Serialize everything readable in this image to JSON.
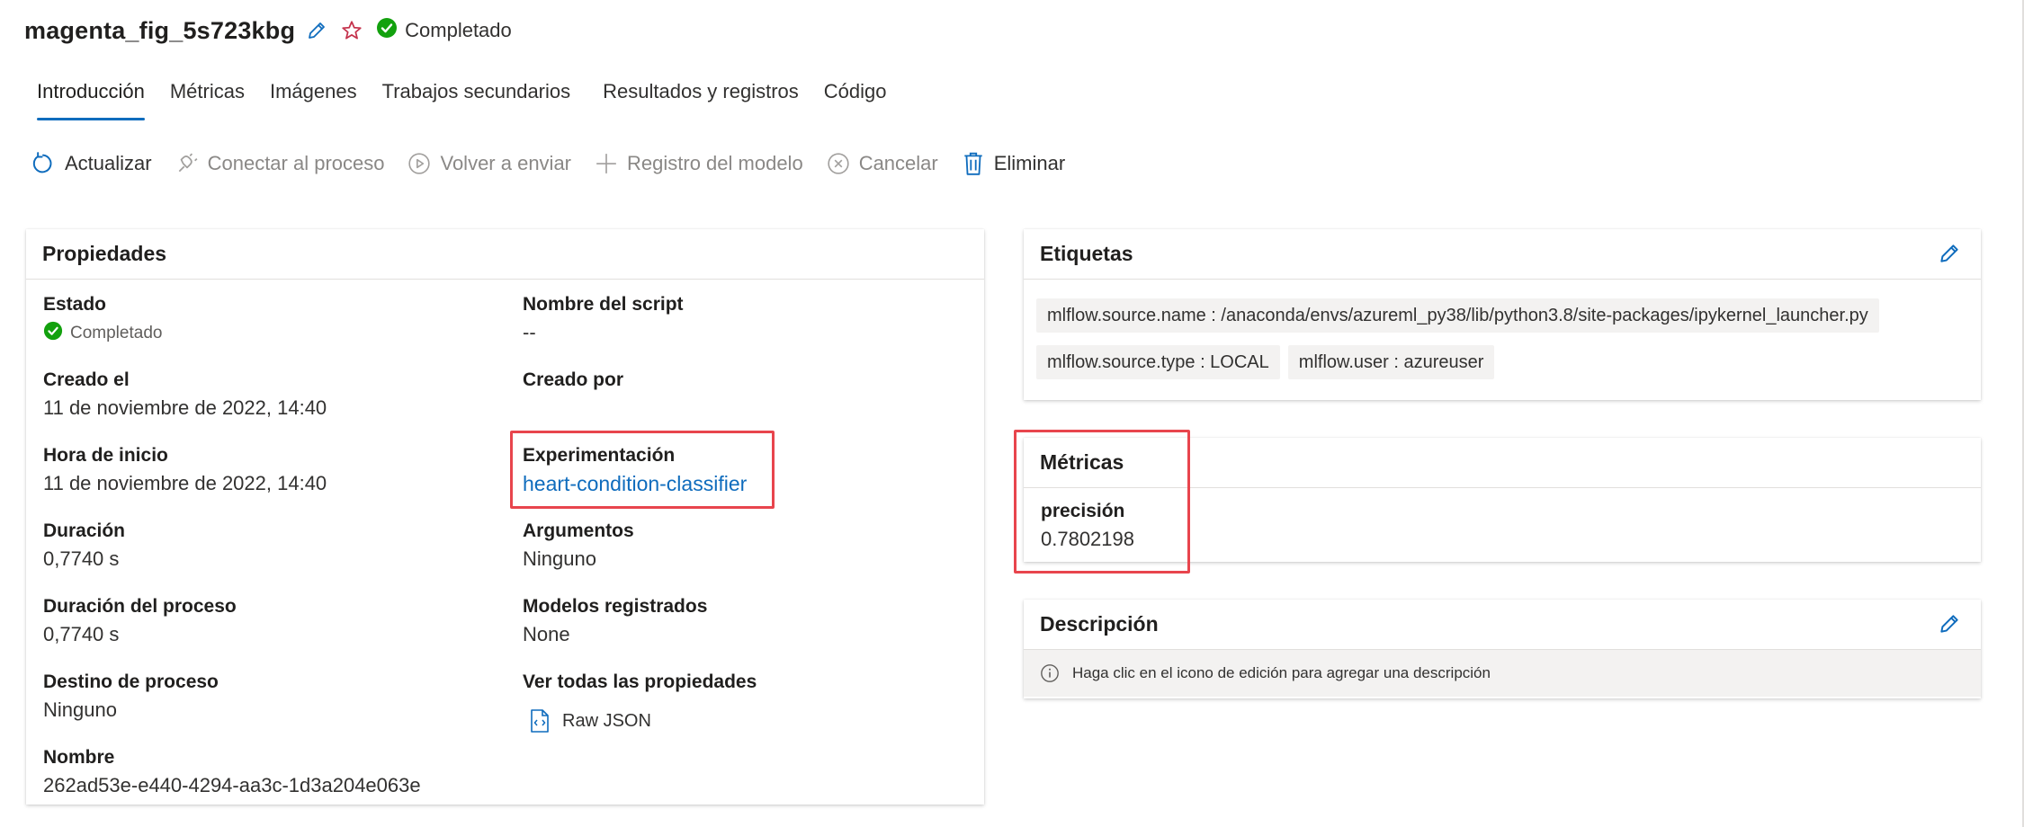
{
  "header": {
    "title": "magenta_fig_5s723kbg",
    "status": "Completado",
    "colors": {
      "success": "#13a10e",
      "accent": "#0f6cbd",
      "favorite": "#c4314b"
    }
  },
  "tabs": [
    {
      "label": "Introducción",
      "active": true
    },
    {
      "label": "Métricas"
    },
    {
      "label": "Imágenes"
    },
    {
      "label": "Trabajos secundarios"
    },
    {
      "label": "Resultados y registros"
    },
    {
      "label": "Código"
    }
  ],
  "toolbar": {
    "refresh": "Actualizar",
    "connect": "Conectar al proceso",
    "resubmit": "Volver a enviar",
    "register_model": "Registro del modelo",
    "cancel": "Cancelar",
    "delete": "Eliminar"
  },
  "properties": {
    "title": "Propiedades",
    "estado_label": "Estado",
    "estado_value": "Completado",
    "creado_el_label": "Creado el",
    "creado_el_value": "11 de noviembre de 2022, 14:40",
    "hora_inicio_label": "Hora de inicio",
    "hora_inicio_value": "11 de noviembre de 2022, 14:40",
    "duracion_label": "Duración",
    "duracion_value": "0,7740 s",
    "duracion_proceso_label": "Duración del proceso",
    "duracion_proceso_value": "0,7740 s",
    "destino_label": "Destino de proceso",
    "destino_value": "Ninguno",
    "nombre_label": "Nombre",
    "nombre_value": "262ad53e-e440-4294-aa3c-1d3a204e063e",
    "script_label": "Nombre del script",
    "script_value": "--",
    "creado_por_label": "Creado por",
    "experimento_label": "Experimentación",
    "experimento_value": "heart-condition-classifier",
    "argumentos_label": "Argumentos",
    "argumentos_value": "Ninguno",
    "modelos_label": "Modelos registrados",
    "modelos_value": "None",
    "ver_todas_label": "Ver todas las propiedades",
    "raw_json": "Raw JSON"
  },
  "tags": {
    "title": "Etiquetas",
    "items": [
      "mlflow.source.name : /anaconda/envs/azureml_py38/lib/python3.8/site-packages/ipykernel_launcher.py",
      "mlflow.source.type : LOCAL",
      "mlflow.user : azureuser"
    ]
  },
  "metrics": {
    "title": "Métricas",
    "name": "precisión",
    "value": "0.7802198"
  },
  "description": {
    "title": "Descripción",
    "placeholder": "Haga clic en el icono de edición para agregar una descripción"
  }
}
